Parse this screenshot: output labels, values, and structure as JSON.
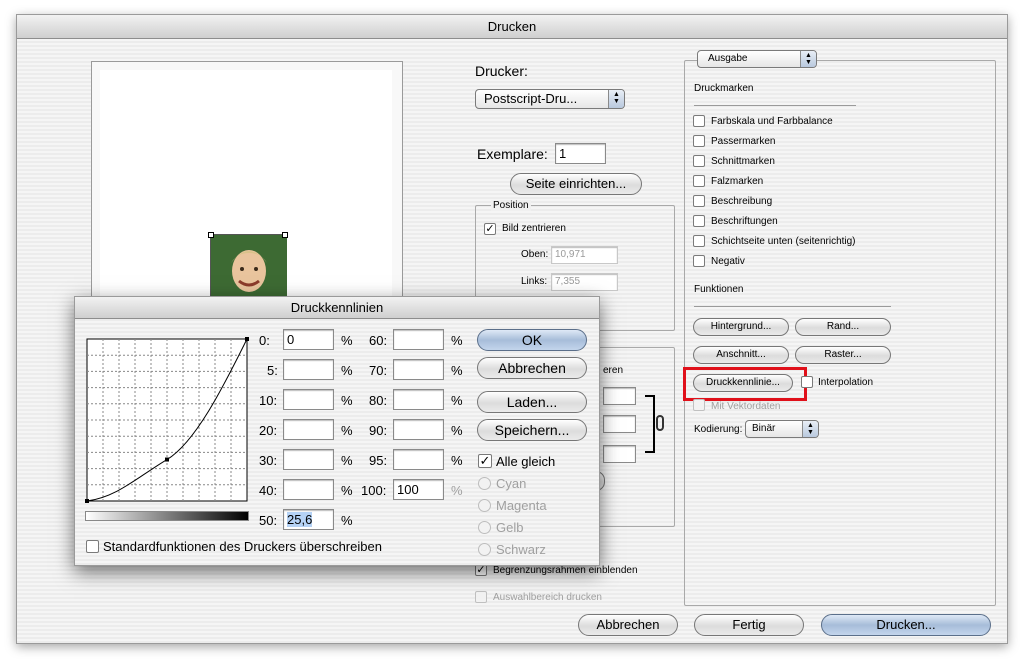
{
  "window": {
    "title": "Drucken"
  },
  "preview": {
    "image_alt": "portrait-thumbnail"
  },
  "printer": {
    "label": "Drucker:",
    "selected": "Postscript-Dru...",
    "copies_label": "Exemplare:",
    "copies_value": "1",
    "page_setup_button": "Seite einrichten..."
  },
  "position": {
    "title": "Position",
    "center_label": "Bild zentrieren",
    "center_checked": true,
    "top_label": "Oben:",
    "top_value": "10,971",
    "left_label": "Links:",
    "left_value": "7,355"
  },
  "scaled": {
    "partial_label": "eren",
    "bounding_label": "Begrenzungsrahmen einblenden",
    "bounding_checked": true,
    "selection_label": "Auswahlbereich drucken",
    "selection_checked": false
  },
  "output": {
    "dropdown": "Ausgabe",
    "marks_heading": "Druckmarken",
    "marks": [
      {
        "label": "Farbskala und Farbbalance",
        "checked": false
      },
      {
        "label": "Passermarken",
        "checked": false
      },
      {
        "label": "Schnittmarken",
        "checked": false
      },
      {
        "label": "Falzmarken",
        "checked": false
      },
      {
        "label": "Beschreibung",
        "checked": false
      },
      {
        "label": "Beschriftungen",
        "checked": false
      },
      {
        "label": "Schichtseite unten (seitenrichtig)",
        "checked": false
      },
      {
        "label": "Negativ",
        "checked": false
      }
    ],
    "functions_heading": "Funktionen",
    "buttons": {
      "background": "Hintergrund...",
      "border": "Rand...",
      "bleed": "Anschnitt...",
      "screen": "Raster...",
      "transfer": "Druckkennlinie..."
    },
    "interpolation_label": "Interpolation",
    "vector_label": "Mit Vektordaten",
    "encoding_label": "Kodierung:",
    "encoding_value": "Binär",
    "highlight_color": "#e0101a"
  },
  "footer": {
    "cancel": "Abbrechen",
    "done": "Fertig",
    "print": "Drucken..."
  },
  "transfer_dialog": {
    "title": "Druckkennlinien",
    "percent": "%",
    "fields_left": [
      {
        "label": "0:",
        "value": "0"
      },
      {
        "label": "5:",
        "value": ""
      },
      {
        "label": "10:",
        "value": ""
      },
      {
        "label": "20:",
        "value": ""
      },
      {
        "label": "30:",
        "value": ""
      },
      {
        "label": "40:",
        "value": ""
      },
      {
        "label": "50:",
        "value": "25,6"
      }
    ],
    "fields_right": [
      {
        "label": "60:",
        "value": ""
      },
      {
        "label": "70:",
        "value": ""
      },
      {
        "label": "80:",
        "value": ""
      },
      {
        "label": "90:",
        "value": ""
      },
      {
        "label": "95:",
        "value": ""
      },
      {
        "label": "100:",
        "value": "100"
      }
    ],
    "ok": "OK",
    "cancel": "Abbrechen",
    "load": "Laden...",
    "save": "Speichern...",
    "all_same_label": "Alle gleich",
    "all_same_checked": true,
    "channels": [
      "Cyan",
      "Magenta",
      "Gelb",
      "Schwarz"
    ],
    "override_label": "Standardfunktionen des Druckers überschreiben",
    "override_checked": false,
    "curve_points": [
      [
        0,
        0
      ],
      [
        50,
        25.6
      ],
      [
        100,
        100
      ]
    ]
  }
}
